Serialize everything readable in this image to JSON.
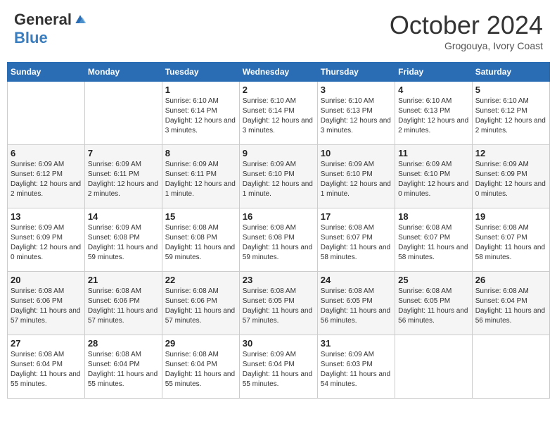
{
  "header": {
    "logo_general": "General",
    "logo_blue": "Blue",
    "month": "October 2024",
    "location": "Grogouya, Ivory Coast"
  },
  "weekdays": [
    "Sunday",
    "Monday",
    "Tuesday",
    "Wednesday",
    "Thursday",
    "Friday",
    "Saturday"
  ],
  "weeks": [
    [
      {
        "day": "",
        "info": ""
      },
      {
        "day": "",
        "info": ""
      },
      {
        "day": "1",
        "info": "Sunrise: 6:10 AM\nSunset: 6:14 PM\nDaylight: 12 hours and 3 minutes."
      },
      {
        "day": "2",
        "info": "Sunrise: 6:10 AM\nSunset: 6:14 PM\nDaylight: 12 hours and 3 minutes."
      },
      {
        "day": "3",
        "info": "Sunrise: 6:10 AM\nSunset: 6:13 PM\nDaylight: 12 hours and 3 minutes."
      },
      {
        "day": "4",
        "info": "Sunrise: 6:10 AM\nSunset: 6:13 PM\nDaylight: 12 hours and 2 minutes."
      },
      {
        "day": "5",
        "info": "Sunrise: 6:10 AM\nSunset: 6:12 PM\nDaylight: 12 hours and 2 minutes."
      }
    ],
    [
      {
        "day": "6",
        "info": "Sunrise: 6:09 AM\nSunset: 6:12 PM\nDaylight: 12 hours and 2 minutes."
      },
      {
        "day": "7",
        "info": "Sunrise: 6:09 AM\nSunset: 6:11 PM\nDaylight: 12 hours and 2 minutes."
      },
      {
        "day": "8",
        "info": "Sunrise: 6:09 AM\nSunset: 6:11 PM\nDaylight: 12 hours and 1 minute."
      },
      {
        "day": "9",
        "info": "Sunrise: 6:09 AM\nSunset: 6:10 PM\nDaylight: 12 hours and 1 minute."
      },
      {
        "day": "10",
        "info": "Sunrise: 6:09 AM\nSunset: 6:10 PM\nDaylight: 12 hours and 1 minute."
      },
      {
        "day": "11",
        "info": "Sunrise: 6:09 AM\nSunset: 6:10 PM\nDaylight: 12 hours and 0 minutes."
      },
      {
        "day": "12",
        "info": "Sunrise: 6:09 AM\nSunset: 6:09 PM\nDaylight: 12 hours and 0 minutes."
      }
    ],
    [
      {
        "day": "13",
        "info": "Sunrise: 6:09 AM\nSunset: 6:09 PM\nDaylight: 12 hours and 0 minutes."
      },
      {
        "day": "14",
        "info": "Sunrise: 6:09 AM\nSunset: 6:08 PM\nDaylight: 11 hours and 59 minutes."
      },
      {
        "day": "15",
        "info": "Sunrise: 6:08 AM\nSunset: 6:08 PM\nDaylight: 11 hours and 59 minutes."
      },
      {
        "day": "16",
        "info": "Sunrise: 6:08 AM\nSunset: 6:08 PM\nDaylight: 11 hours and 59 minutes."
      },
      {
        "day": "17",
        "info": "Sunrise: 6:08 AM\nSunset: 6:07 PM\nDaylight: 11 hours and 58 minutes."
      },
      {
        "day": "18",
        "info": "Sunrise: 6:08 AM\nSunset: 6:07 PM\nDaylight: 11 hours and 58 minutes."
      },
      {
        "day": "19",
        "info": "Sunrise: 6:08 AM\nSunset: 6:07 PM\nDaylight: 11 hours and 58 minutes."
      }
    ],
    [
      {
        "day": "20",
        "info": "Sunrise: 6:08 AM\nSunset: 6:06 PM\nDaylight: 11 hours and 57 minutes."
      },
      {
        "day": "21",
        "info": "Sunrise: 6:08 AM\nSunset: 6:06 PM\nDaylight: 11 hours and 57 minutes."
      },
      {
        "day": "22",
        "info": "Sunrise: 6:08 AM\nSunset: 6:06 PM\nDaylight: 11 hours and 57 minutes."
      },
      {
        "day": "23",
        "info": "Sunrise: 6:08 AM\nSunset: 6:05 PM\nDaylight: 11 hours and 57 minutes."
      },
      {
        "day": "24",
        "info": "Sunrise: 6:08 AM\nSunset: 6:05 PM\nDaylight: 11 hours and 56 minutes."
      },
      {
        "day": "25",
        "info": "Sunrise: 6:08 AM\nSunset: 6:05 PM\nDaylight: 11 hours and 56 minutes."
      },
      {
        "day": "26",
        "info": "Sunrise: 6:08 AM\nSunset: 6:04 PM\nDaylight: 11 hours and 56 minutes."
      }
    ],
    [
      {
        "day": "27",
        "info": "Sunrise: 6:08 AM\nSunset: 6:04 PM\nDaylight: 11 hours and 55 minutes."
      },
      {
        "day": "28",
        "info": "Sunrise: 6:08 AM\nSunset: 6:04 PM\nDaylight: 11 hours and 55 minutes."
      },
      {
        "day": "29",
        "info": "Sunrise: 6:08 AM\nSunset: 6:04 PM\nDaylight: 11 hours and 55 minutes."
      },
      {
        "day": "30",
        "info": "Sunrise: 6:09 AM\nSunset: 6:04 PM\nDaylight: 11 hours and 55 minutes."
      },
      {
        "day": "31",
        "info": "Sunrise: 6:09 AM\nSunset: 6:03 PM\nDaylight: 11 hours and 54 minutes."
      },
      {
        "day": "",
        "info": ""
      },
      {
        "day": "",
        "info": ""
      }
    ]
  ]
}
